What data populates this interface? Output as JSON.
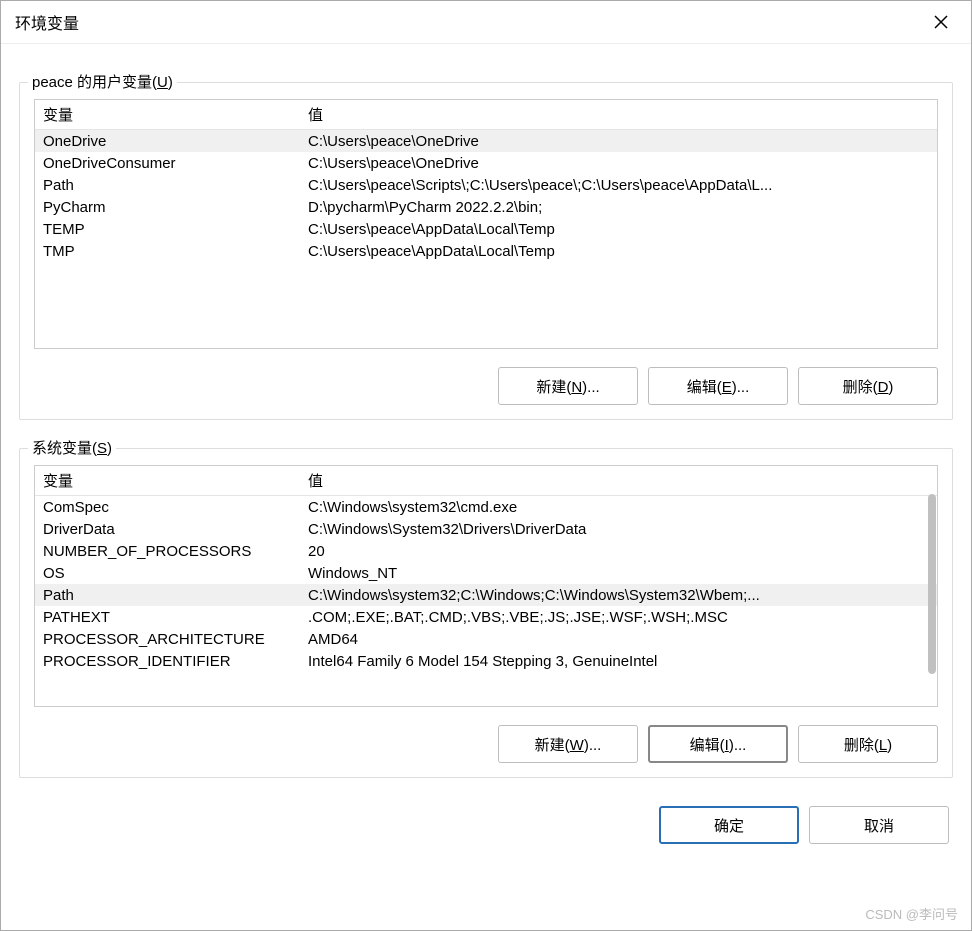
{
  "dialog": {
    "title": "环境变量"
  },
  "user_section": {
    "label_pre": "peace 的用户变量(",
    "label_hotkey": "U",
    "label_post": ")",
    "columns": {
      "name": "变量",
      "value": "值"
    },
    "rows": [
      {
        "name": "OneDrive",
        "value": "C:\\Users\\peace\\OneDrive",
        "selected": true
      },
      {
        "name": "OneDriveConsumer",
        "value": "C:\\Users\\peace\\OneDrive"
      },
      {
        "name": "Path",
        "value": "C:\\Users\\peace\\Scripts\\;C:\\Users\\peace\\;C:\\Users\\peace\\AppData\\L..."
      },
      {
        "name": "PyCharm",
        "value": "D:\\pycharm\\PyCharm 2022.2.2\\bin;"
      },
      {
        "name": "TEMP",
        "value": "C:\\Users\\peace\\AppData\\Local\\Temp"
      },
      {
        "name": "TMP",
        "value": "C:\\Users\\peace\\AppData\\Local\\Temp"
      }
    ],
    "buttons": {
      "new_pre": "新建(",
      "new_hot": "N",
      "new_post": ")...",
      "edit_pre": "编辑(",
      "edit_hot": "E",
      "edit_post": ")...",
      "del_pre": "删除(",
      "del_hot": "D",
      "del_post": ")"
    }
  },
  "system_section": {
    "label_pre": "系统变量(",
    "label_hotkey": "S",
    "label_post": ")",
    "columns": {
      "name": "变量",
      "value": "值"
    },
    "rows": [
      {
        "name": "ComSpec",
        "value": "C:\\Windows\\system32\\cmd.exe"
      },
      {
        "name": "DriverData",
        "value": "C:\\Windows\\System32\\Drivers\\DriverData"
      },
      {
        "name": "NUMBER_OF_PROCESSORS",
        "value": "20"
      },
      {
        "name": "OS",
        "value": "Windows_NT"
      },
      {
        "name": "Path",
        "value": "C:\\Windows\\system32;C:\\Windows;C:\\Windows\\System32\\Wbem;...",
        "selected": true
      },
      {
        "name": "PATHEXT",
        "value": ".COM;.EXE;.BAT;.CMD;.VBS;.VBE;.JS;.JSE;.WSF;.WSH;.MSC"
      },
      {
        "name": "PROCESSOR_ARCHITECTURE",
        "value": "AMD64"
      },
      {
        "name": "PROCESSOR_IDENTIFIER",
        "value": "Intel64 Family 6 Model 154 Stepping 3, GenuineIntel"
      }
    ],
    "buttons": {
      "new_pre": "新建(",
      "new_hot": "W",
      "new_post": ")...",
      "edit_pre": "编辑(",
      "edit_hot": "I",
      "edit_post": ")...",
      "del_pre": "删除(",
      "del_hot": "L",
      "del_post": ")"
    }
  },
  "dialog_buttons": {
    "ok": "确定",
    "cancel": "取消"
  },
  "watermark": "CSDN @李问号"
}
